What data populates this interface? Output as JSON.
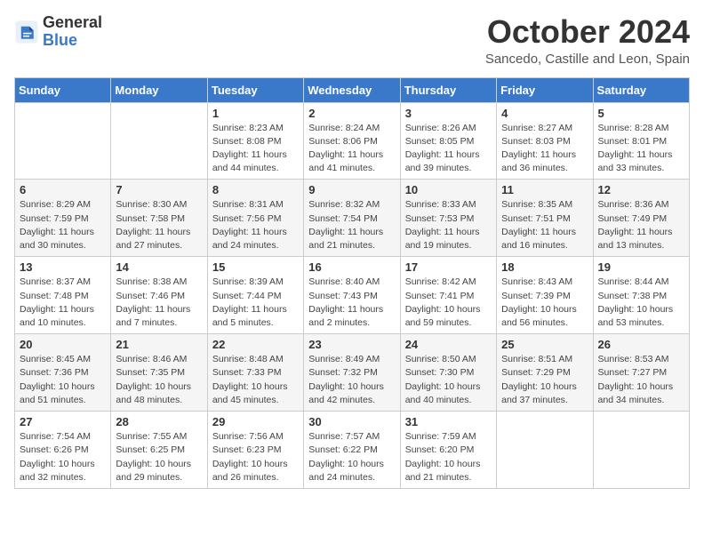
{
  "logo": {
    "line1": "General",
    "line2": "Blue"
  },
  "title": "October 2024",
  "location": "Sancedo, Castille and Leon, Spain",
  "days_of_week": [
    "Sunday",
    "Monday",
    "Tuesday",
    "Wednesday",
    "Thursday",
    "Friday",
    "Saturday"
  ],
  "weeks": [
    [
      {
        "day": "",
        "info": ""
      },
      {
        "day": "",
        "info": ""
      },
      {
        "day": "1",
        "info": "Sunrise: 8:23 AM\nSunset: 8:08 PM\nDaylight: 11 hours and 44 minutes."
      },
      {
        "day": "2",
        "info": "Sunrise: 8:24 AM\nSunset: 8:06 PM\nDaylight: 11 hours and 41 minutes."
      },
      {
        "day": "3",
        "info": "Sunrise: 8:26 AM\nSunset: 8:05 PM\nDaylight: 11 hours and 39 minutes."
      },
      {
        "day": "4",
        "info": "Sunrise: 8:27 AM\nSunset: 8:03 PM\nDaylight: 11 hours and 36 minutes."
      },
      {
        "day": "5",
        "info": "Sunrise: 8:28 AM\nSunset: 8:01 PM\nDaylight: 11 hours and 33 minutes."
      }
    ],
    [
      {
        "day": "6",
        "info": "Sunrise: 8:29 AM\nSunset: 7:59 PM\nDaylight: 11 hours and 30 minutes."
      },
      {
        "day": "7",
        "info": "Sunrise: 8:30 AM\nSunset: 7:58 PM\nDaylight: 11 hours and 27 minutes."
      },
      {
        "day": "8",
        "info": "Sunrise: 8:31 AM\nSunset: 7:56 PM\nDaylight: 11 hours and 24 minutes."
      },
      {
        "day": "9",
        "info": "Sunrise: 8:32 AM\nSunset: 7:54 PM\nDaylight: 11 hours and 21 minutes."
      },
      {
        "day": "10",
        "info": "Sunrise: 8:33 AM\nSunset: 7:53 PM\nDaylight: 11 hours and 19 minutes."
      },
      {
        "day": "11",
        "info": "Sunrise: 8:35 AM\nSunset: 7:51 PM\nDaylight: 11 hours and 16 minutes."
      },
      {
        "day": "12",
        "info": "Sunrise: 8:36 AM\nSunset: 7:49 PM\nDaylight: 11 hours and 13 minutes."
      }
    ],
    [
      {
        "day": "13",
        "info": "Sunrise: 8:37 AM\nSunset: 7:48 PM\nDaylight: 11 hours and 10 minutes."
      },
      {
        "day": "14",
        "info": "Sunrise: 8:38 AM\nSunset: 7:46 PM\nDaylight: 11 hours and 7 minutes."
      },
      {
        "day": "15",
        "info": "Sunrise: 8:39 AM\nSunset: 7:44 PM\nDaylight: 11 hours and 5 minutes."
      },
      {
        "day": "16",
        "info": "Sunrise: 8:40 AM\nSunset: 7:43 PM\nDaylight: 11 hours and 2 minutes."
      },
      {
        "day": "17",
        "info": "Sunrise: 8:42 AM\nSunset: 7:41 PM\nDaylight: 10 hours and 59 minutes."
      },
      {
        "day": "18",
        "info": "Sunrise: 8:43 AM\nSunset: 7:39 PM\nDaylight: 10 hours and 56 minutes."
      },
      {
        "day": "19",
        "info": "Sunrise: 8:44 AM\nSunset: 7:38 PM\nDaylight: 10 hours and 53 minutes."
      }
    ],
    [
      {
        "day": "20",
        "info": "Sunrise: 8:45 AM\nSunset: 7:36 PM\nDaylight: 10 hours and 51 minutes."
      },
      {
        "day": "21",
        "info": "Sunrise: 8:46 AM\nSunset: 7:35 PM\nDaylight: 10 hours and 48 minutes."
      },
      {
        "day": "22",
        "info": "Sunrise: 8:48 AM\nSunset: 7:33 PM\nDaylight: 10 hours and 45 minutes."
      },
      {
        "day": "23",
        "info": "Sunrise: 8:49 AM\nSunset: 7:32 PM\nDaylight: 10 hours and 42 minutes."
      },
      {
        "day": "24",
        "info": "Sunrise: 8:50 AM\nSunset: 7:30 PM\nDaylight: 10 hours and 40 minutes."
      },
      {
        "day": "25",
        "info": "Sunrise: 8:51 AM\nSunset: 7:29 PM\nDaylight: 10 hours and 37 minutes."
      },
      {
        "day": "26",
        "info": "Sunrise: 8:53 AM\nSunset: 7:27 PM\nDaylight: 10 hours and 34 minutes."
      }
    ],
    [
      {
        "day": "27",
        "info": "Sunrise: 7:54 AM\nSunset: 6:26 PM\nDaylight: 10 hours and 32 minutes."
      },
      {
        "day": "28",
        "info": "Sunrise: 7:55 AM\nSunset: 6:25 PM\nDaylight: 10 hours and 29 minutes."
      },
      {
        "day": "29",
        "info": "Sunrise: 7:56 AM\nSunset: 6:23 PM\nDaylight: 10 hours and 26 minutes."
      },
      {
        "day": "30",
        "info": "Sunrise: 7:57 AM\nSunset: 6:22 PM\nDaylight: 10 hours and 24 minutes."
      },
      {
        "day": "31",
        "info": "Sunrise: 7:59 AM\nSunset: 6:20 PM\nDaylight: 10 hours and 21 minutes."
      },
      {
        "day": "",
        "info": ""
      },
      {
        "day": "",
        "info": ""
      }
    ]
  ]
}
